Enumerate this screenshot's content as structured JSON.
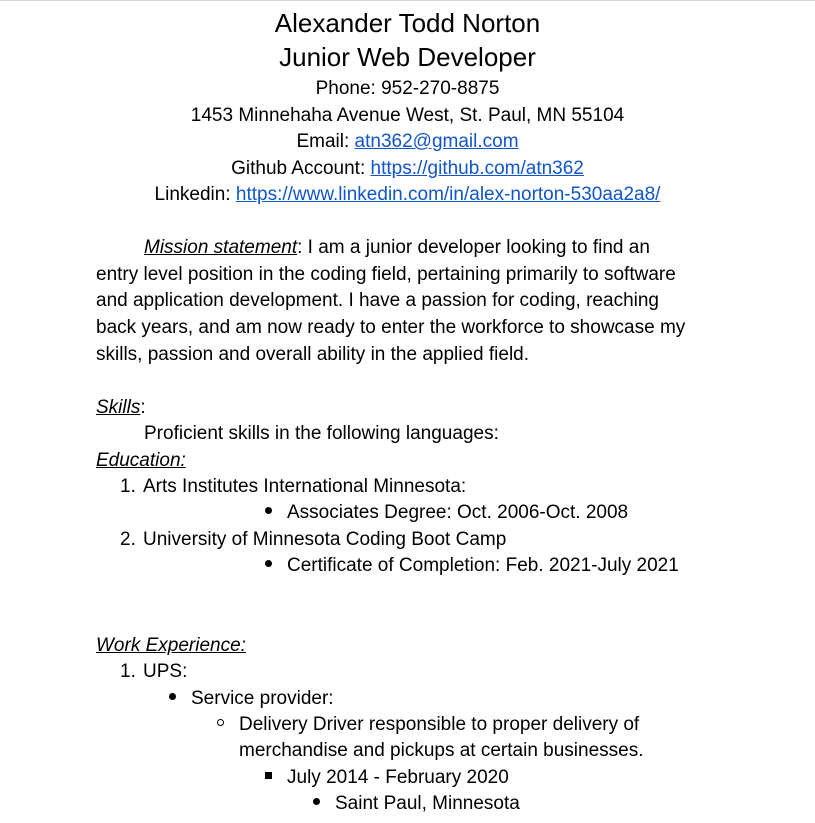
{
  "header": {
    "name": "Alexander Todd Norton",
    "title": "Junior Web Developer",
    "phone": "Phone: 952-270-8875",
    "address": "1453 Minnehaha Avenue West, St. Paul, MN 55104",
    "email_label": "Email: ",
    "email": "atn362@gmail.com",
    "github_label": "Github Account: ",
    "github": "https://github.com/atn362",
    "linkedin_label": "Linkedin:  ",
    "linkedin": "https://www.linkedin.com/in/alex-norton-530aa2a8/"
  },
  "mission": {
    "label": "Mission statement",
    "lines": [
      ": I am a junior developer looking to find an",
      "entry level position in the coding field, pertaining primarily to software",
      "and application development.  I have a passion for coding, reaching",
      "back years, and am now ready to enter the workforce to showcase my",
      "skills, passion and overall ability in the applied field."
    ]
  },
  "skills": {
    "label": "Skills",
    "colon": ":",
    "text": "Proficient skills in the following languages:"
  },
  "education": {
    "label": "Education:",
    "items": [
      {
        "num": "1.",
        "school": "Arts Institutes International Minnesota:",
        "detail": "Associates Degree: Oct. 2006-Oct. 2008"
      },
      {
        "num": "2.",
        "school": "University of Minnesota Coding Boot Camp",
        "detail": "Certificate of Completion: Feb. 2021-July 2021"
      }
    ]
  },
  "work": {
    "label": "Work Experience:",
    "num": "1.",
    "employer": "UPS:",
    "role": "Service provider:",
    "desc_lines": [
      "Delivery Driver responsible to proper delivery of",
      "merchandise and pickups at certain businesses."
    ],
    "dates": "July 2014 - February 2020",
    "location": "Saint Paul, Minnesota"
  },
  "colors": {
    "link": "#1155cc",
    "text": "#000000"
  }
}
